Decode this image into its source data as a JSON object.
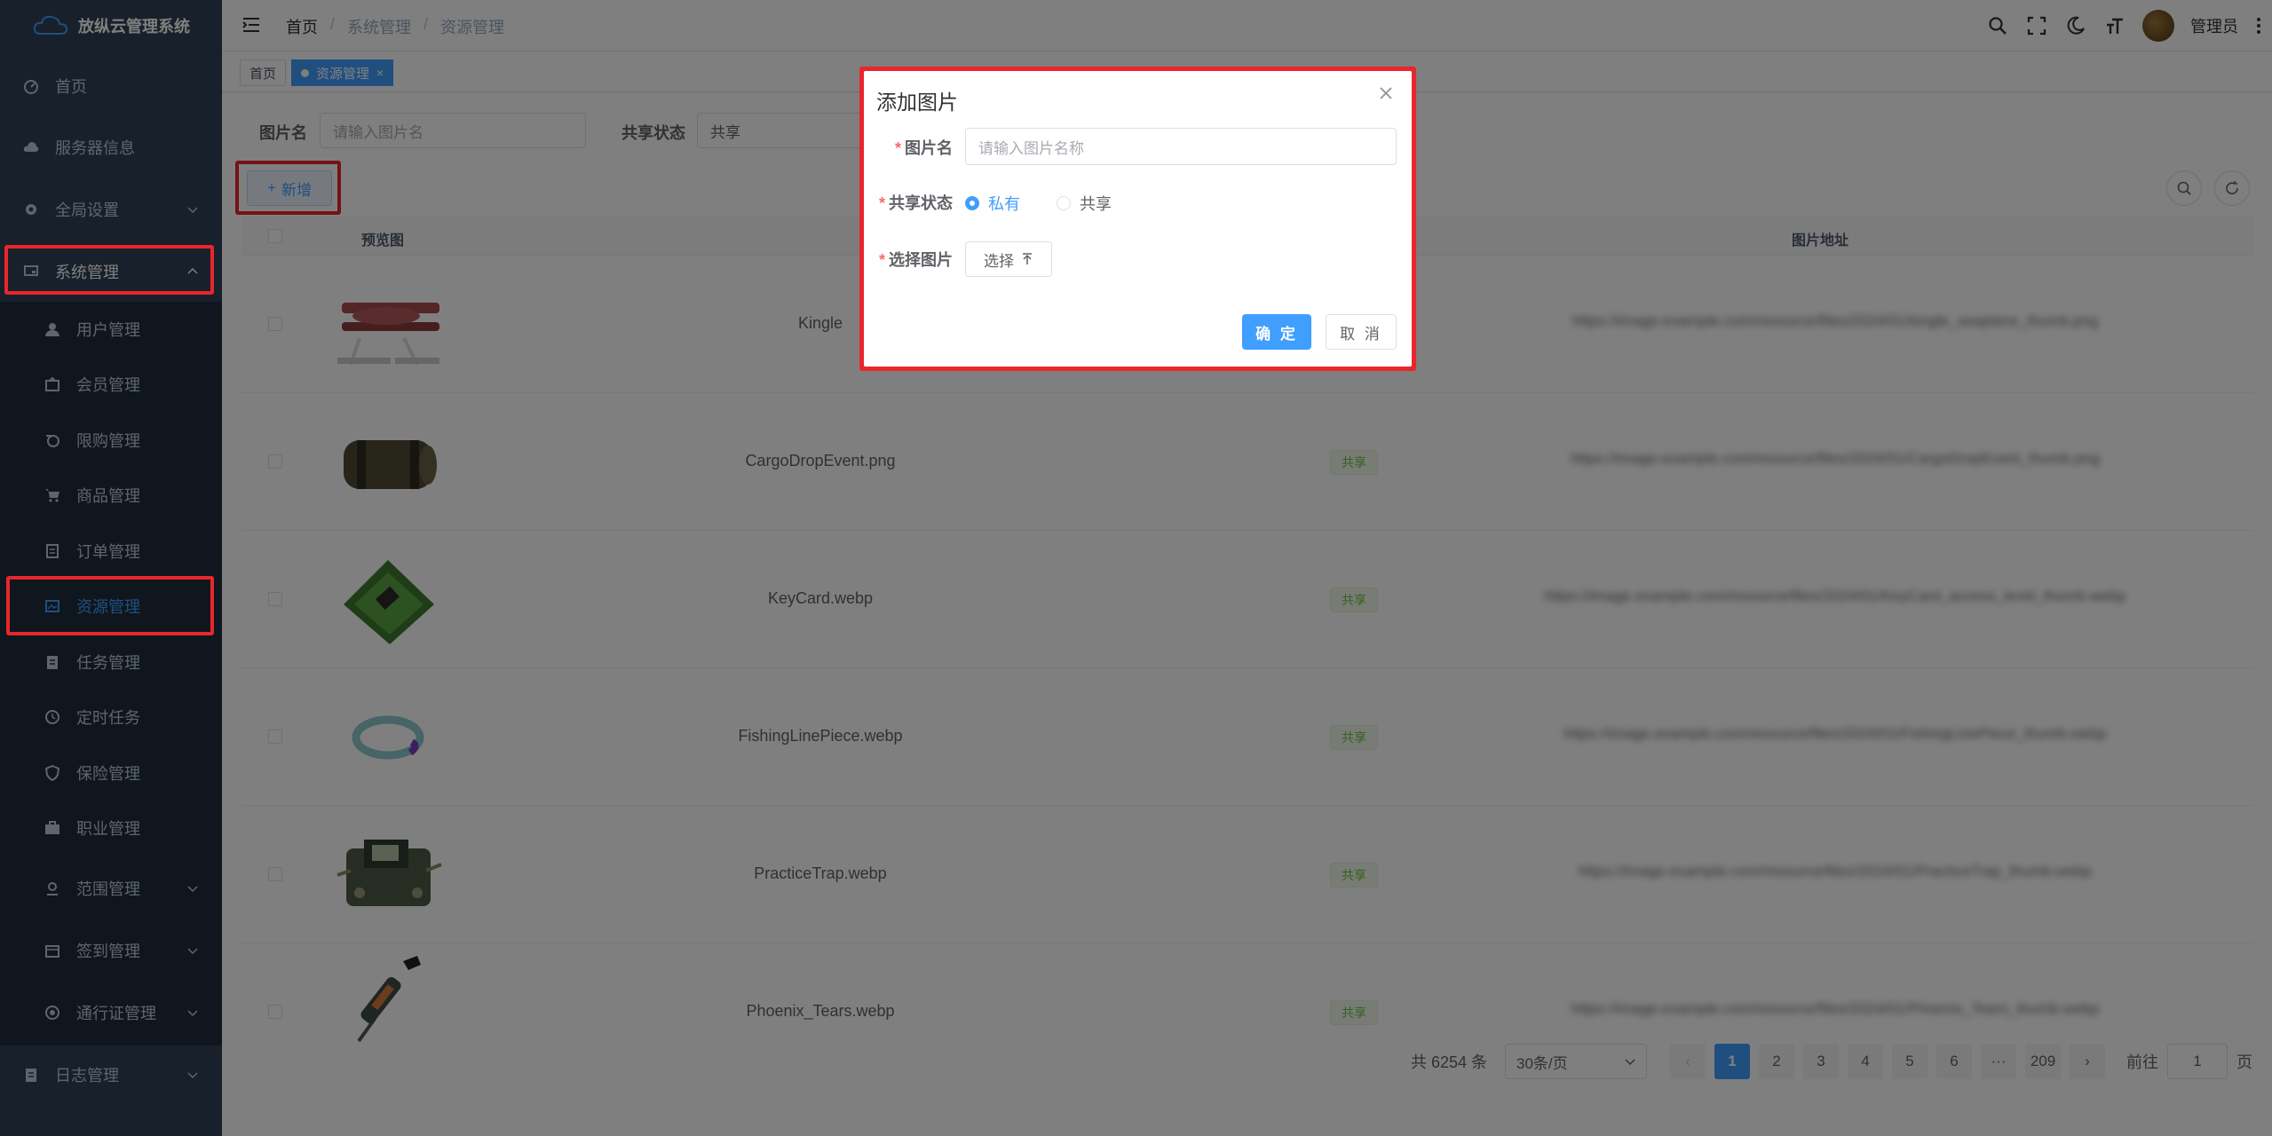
{
  "app": {
    "title": "放纵云管理系统"
  },
  "sidebar": {
    "items": [
      {
        "label": "首页",
        "icon": "dashboard-icon"
      },
      {
        "label": "服务器信息",
        "icon": "cloud-icon"
      },
      {
        "label": "全局设置",
        "icon": "gear-icon"
      },
      {
        "label": "系统管理",
        "icon": "monitor-icon"
      },
      {
        "label": "用户管理",
        "icon": "user-icon"
      },
      {
        "label": "会员管理",
        "icon": "member-icon"
      },
      {
        "label": "限购管理",
        "icon": "limit-icon"
      },
      {
        "label": "商品管理",
        "icon": "cart-icon"
      },
      {
        "label": "订单管理",
        "icon": "order-icon"
      },
      {
        "label": "资源管理",
        "icon": "image-icon"
      },
      {
        "label": "任务管理",
        "icon": "task-icon"
      },
      {
        "label": "定时任务",
        "icon": "clock-icon"
      },
      {
        "label": "保险管理",
        "icon": "shield-icon"
      },
      {
        "label": "职业管理",
        "icon": "briefcase-icon"
      },
      {
        "label": "范围管理",
        "icon": "range-icon"
      },
      {
        "label": "签到管理",
        "icon": "calendar-icon"
      },
      {
        "label": "通行证管理",
        "icon": "pass-icon"
      },
      {
        "label": "日志管理",
        "icon": "log-icon"
      }
    ]
  },
  "header": {
    "breadcrumb": [
      "首页",
      "系统管理",
      "资源管理"
    ],
    "user_name": "管理员"
  },
  "tags": {
    "home": "首页",
    "current": "资源管理"
  },
  "search": {
    "name_label": "图片名",
    "name_placeholder": "请输入图片名",
    "share_label": "共享状态",
    "share_value": "共享"
  },
  "toolbar": {
    "add_label": "新增"
  },
  "table": {
    "columns": [
      "预览图",
      "图片地址"
    ],
    "rows": [
      {
        "name": "Kingle",
        "share": "",
        "url": "https://image.example.com/resource/files/2024/01/kingle_seaplane_thumb.png"
      },
      {
        "name": "CargoDropEvent.png",
        "share": "共享",
        "url": "https://image.example.com/resource/files/2024/01/CargoDropEvent_thumb.png"
      },
      {
        "name": "KeyCard.webp",
        "share": "共享",
        "url": "https://image.example.com/resource/files/2024/01/KeyCard_access_level_thumb.webp"
      },
      {
        "name": "FishingLinePiece.webp",
        "share": "共享",
        "url": "https://image.example.com/resource/files/2024/01/FishingLinePiece_thumb.webp"
      },
      {
        "name": "PracticeTrap.webp",
        "share": "共享",
        "url": "https://image.example.com/resource/files/2024/01/PracticeTrap_thumb.webp"
      },
      {
        "name": "Phoenix_Tears.webp",
        "share": "共享",
        "url": "https://image.example.com/resource/files/2024/01/Phoenix_Tears_thumb.webp"
      }
    ]
  },
  "pagination": {
    "total": "共 6254 条",
    "page_size": "30条/页",
    "pages": [
      "1",
      "2",
      "3",
      "4",
      "5",
      "6"
    ],
    "ellipsis": "···",
    "last": "209",
    "goto_label": "前往",
    "goto_value": "1",
    "page_suffix": "页"
  },
  "dialog": {
    "title": "添加图片",
    "name_label": "图片名",
    "name_placeholder": "请输入图片名称",
    "share_label": "共享状态",
    "option_private": "私有",
    "option_shared": "共享",
    "select_label": "选择图片",
    "choose_label": "选择",
    "ok_label": "确 定",
    "cancel_label": "取 消",
    "required_mark": "*"
  },
  "colors": {
    "primary": "#409eff",
    "sidebar": "#304156",
    "highlight": "#e8262b",
    "success": "#67c23a"
  }
}
